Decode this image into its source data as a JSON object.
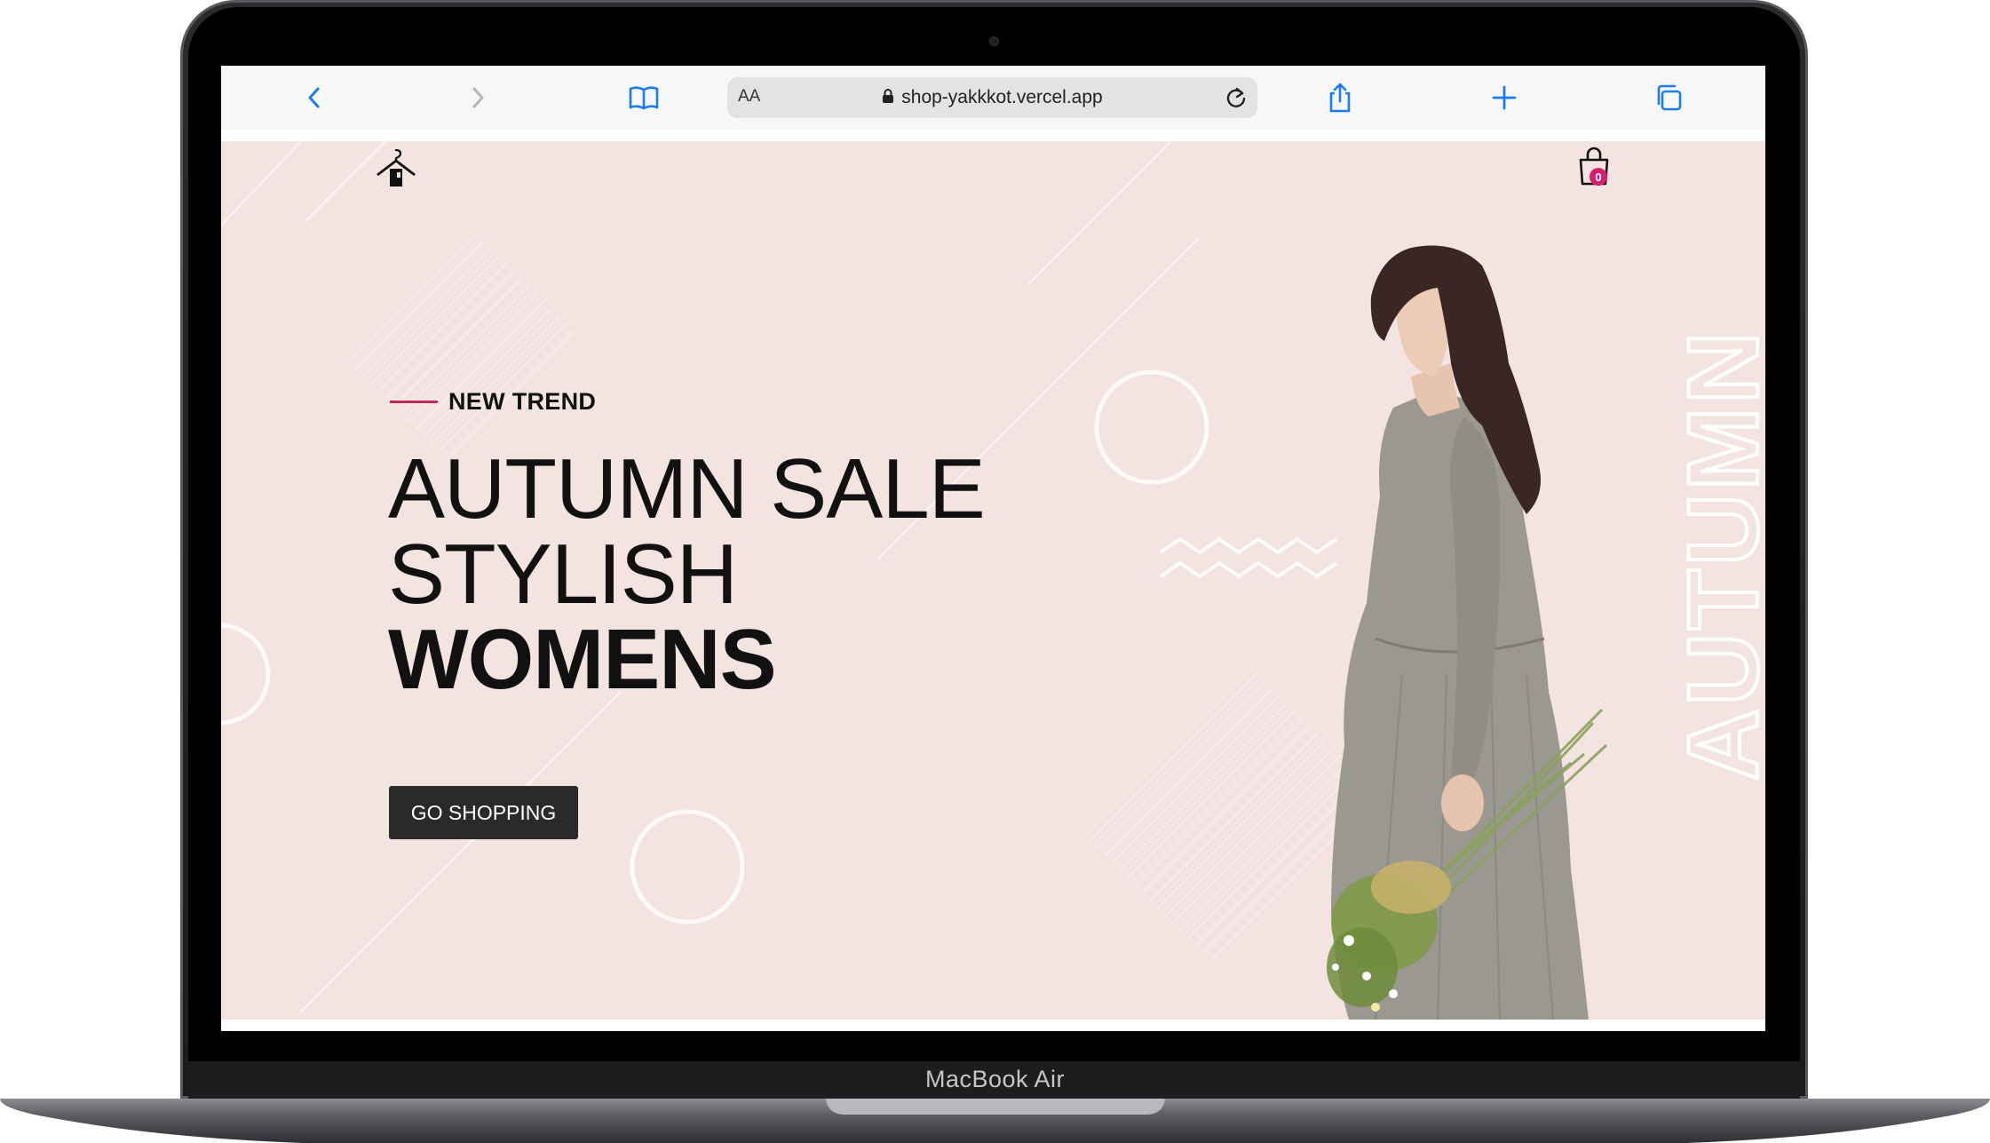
{
  "device": {
    "brand_label": "MacBook Air"
  },
  "browser": {
    "text_size_label": "AA",
    "url": "shop-yakkkot.vercel.app",
    "icons": {
      "back": "chevron-left-icon",
      "forward": "chevron-right-icon",
      "bookmarks": "book-icon",
      "lock": "lock-icon",
      "reload": "reload-icon",
      "share": "share-icon",
      "new_tab": "plus-icon",
      "tabs": "tabs-icon"
    }
  },
  "site": {
    "logo_icon": "hanger-house-icon",
    "cart_icon": "shopping-bag-icon",
    "cart_count": "0",
    "hero": {
      "kicker": "NEW TREND",
      "line1": "AUTUMN SALE",
      "line2": "STYLISH",
      "line3": "WOMENS",
      "cta": "GO SHOPPING",
      "watermark": "AUTUMN"
    }
  },
  "colors": {
    "hero_bg": "#f3e4e1",
    "accent": "#c0285f",
    "cart_badge": "#d81e6e",
    "button_bg": "#2a2a2a",
    "browser_blue": "#1a7cf0"
  }
}
